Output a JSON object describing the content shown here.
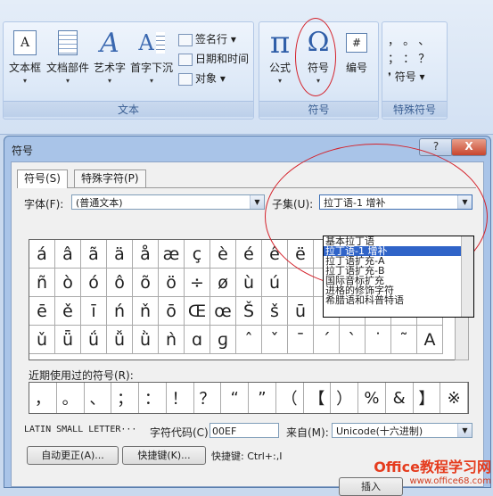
{
  "ribbon": {
    "text_group": {
      "label": "文本",
      "buttons": [
        {
          "label": "文本框",
          "icon": "textbox-icon"
        },
        {
          "label": "文档部件",
          "icon": "quickparts-icon"
        },
        {
          "label": "艺术字",
          "icon": "wordart-icon"
        },
        {
          "label": "首字下沉",
          "icon": "dropcap-icon"
        }
      ],
      "small": [
        {
          "label": "签名行 ▾",
          "icon": "signature-icon"
        },
        {
          "label": "日期和时间",
          "icon": "datetime-icon"
        },
        {
          "label": "对象 ▾",
          "icon": "object-icon"
        }
      ]
    },
    "symbol_group": {
      "label": "符号",
      "buttons": [
        {
          "label": "公式",
          "glyph": "π"
        },
        {
          "label": "符号",
          "glyph": "Ω"
        },
        {
          "label": "编号",
          "glyph": "#"
        }
      ]
    },
    "special_group": {
      "label": "特殊符号",
      "symbols_row1": "，   。  、",
      "symbols_row2": "；   ：  ？",
      "button": "符号 ▾",
      "bullet": "❜"
    }
  },
  "dialog": {
    "title": "符号",
    "help_label": "?",
    "close_label": "X",
    "tabs": [
      "符号(S)",
      "特殊字符(P)"
    ],
    "font_label": "字体(F):",
    "font_value": "(普通文本)",
    "subset_label": "子集(U):",
    "subset_value": "拉丁语-1 增补",
    "subset_options": [
      {
        "label": "基本拉丁语",
        "selected": false
      },
      {
        "label": "拉丁语-1 增补",
        "selected": true
      },
      {
        "label": "拉丁语扩充-A",
        "selected": false
      },
      {
        "label": "拉丁语扩充-B",
        "selected": false
      },
      {
        "label": "国际音标扩充",
        "selected": false
      },
      {
        "label": "进格的修饰字符",
        "selected": false
      },
      {
        "label": "希腊语和科普特语",
        "selected": false
      }
    ],
    "symbols": [
      [
        "á",
        "â",
        "ã",
        "ä",
        "å",
        "æ",
        "ç",
        "è",
        "é",
        "ê",
        "ë",
        "",
        "",
        "",
        "",
        ""
      ],
      [
        "ñ",
        "ò",
        "ó",
        "ô",
        "õ",
        "ö",
        "÷",
        "ø",
        "ù",
        "ú",
        "",
        "",
        "",
        "",
        "",
        ""
      ],
      [
        "ē",
        "ě",
        "ī",
        "ń",
        "ň",
        "ō",
        "Œ",
        "œ",
        "Š",
        "š",
        "ū",
        "",
        "",
        "",
        "",
        ""
      ],
      [
        "ǔ",
        "ǖ",
        "ǘ",
        "ǚ",
        "ǜ",
        "ǹ",
        "ɑ",
        "ɡ",
        "ˆ",
        "ˇ",
        "ˉ",
        "ˊ",
        "ˋ",
        "˙",
        "˜",
        "A"
      ]
    ],
    "recent_label": "近期使用过的符号(R):",
    "recent": [
      "，",
      "。",
      "、",
      "；",
      "：",
      "！",
      "？",
      "“",
      "”",
      "（",
      "【",
      "）",
      "%",
      "&",
      "】",
      "※"
    ],
    "char_name": "LATIN SMALL LETTER···",
    "code_label": "字符代码(C):",
    "code_value": "00EF",
    "from_label": "来自(M):",
    "from_value": "Unicode(十六进制)",
    "autocorrect_button": "自动更正(A)...",
    "shortcut_button": "快捷键(K)...",
    "shortcut_text": "快捷键: Ctrl+:,I",
    "insert_button": "插入"
  },
  "watermark": {
    "line1": "Office教程学习网",
    "line2": "www.office68.com"
  }
}
